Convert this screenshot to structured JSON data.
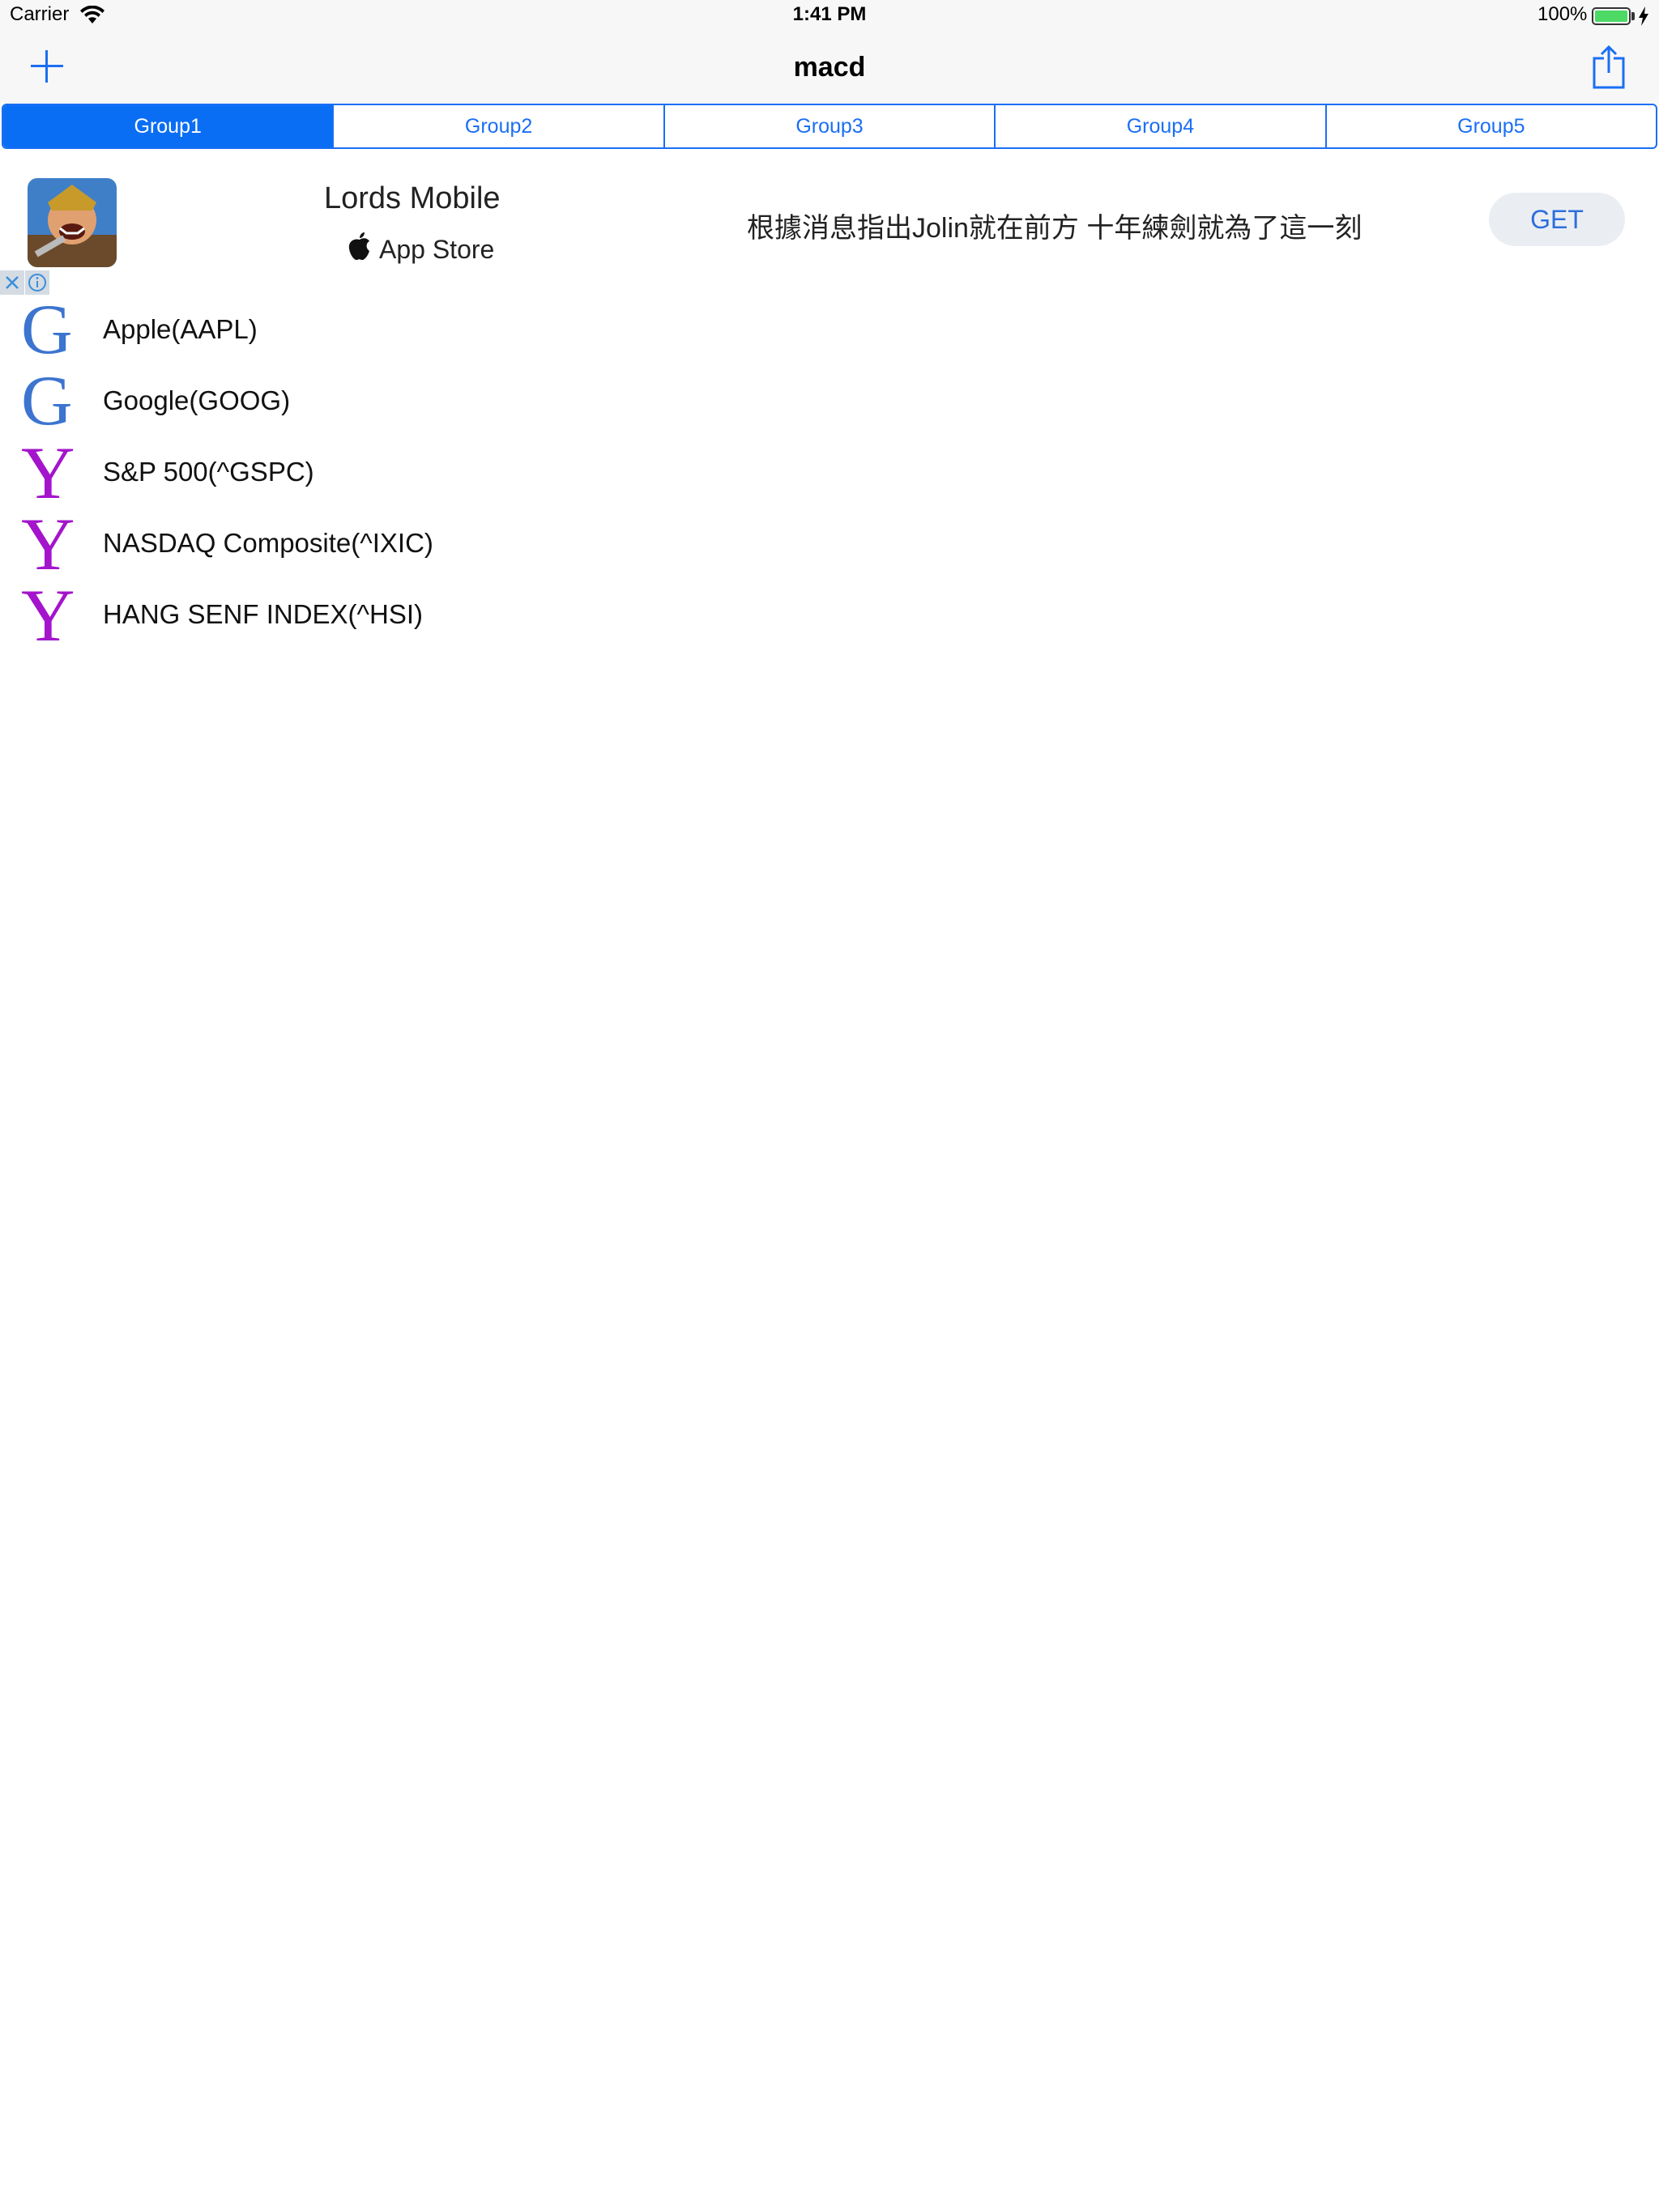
{
  "status_bar": {
    "carrier": "Carrier",
    "time": "1:41 PM",
    "battery_percent": "100%",
    "battery_level": 1.0,
    "wifi_icon": "wifi-icon",
    "charging_icon": "lightning-bolt-icon"
  },
  "nav": {
    "title": "macd",
    "left_icon": "plus-icon",
    "right_icon": "share-icon"
  },
  "segments": [
    {
      "label": "Group1",
      "selected": true
    },
    {
      "label": "Group2",
      "selected": false
    },
    {
      "label": "Group3",
      "selected": false
    },
    {
      "label": "Group4",
      "selected": false
    },
    {
      "label": "Group5",
      "selected": false
    }
  ],
  "ad": {
    "app_name": "Lords Mobile",
    "store_label": "App Store",
    "description": "根據消息指出Jolin就在前方 十年練劍就為了這一刻",
    "cta": "GET",
    "close_icon": "close-icon",
    "info_icon": "info-icon"
  },
  "stocks": [
    {
      "logo": "G",
      "label": "Apple(AAPL)"
    },
    {
      "logo": "G",
      "label": "Google(GOOG)"
    },
    {
      "logo": "Y",
      "label": "S&P 500(^GSPC)"
    },
    {
      "logo": "Y",
      "label": "NASDAQ Composite(^IXIC)"
    },
    {
      "logo": "Y",
      "label": "HANG SENF INDEX(^HSI)"
    }
  ],
  "colors": {
    "accent": "#1a6ff4",
    "google_logo": "#3c74cf",
    "yahoo_logo": "#a414cc",
    "battery": "#4cd964"
  }
}
